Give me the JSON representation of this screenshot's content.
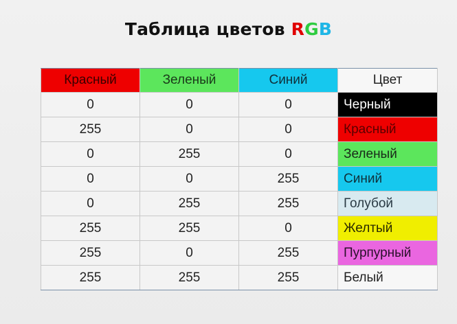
{
  "title": {
    "prefix": "Таблица цветов ",
    "r": "R",
    "g": "G",
    "b": "B"
  },
  "headers": [
    {
      "label": "Красный",
      "bg": "#ee0000",
      "color": "#3a0000"
    },
    {
      "label": "Зеленый",
      "bg": "#5ce65c",
      "color": "#1a3a1a"
    },
    {
      "label": "Синий",
      "bg": "#16c8ee",
      "color": "#10303a"
    },
    {
      "label": "Цвет",
      "bg": "#f7f7f7",
      "color": "#222222"
    }
  ],
  "rows": [
    {
      "r": "0",
      "g": "0",
      "b": "0",
      "name": "Черный",
      "bg": "#000000",
      "text": "#ffffff"
    },
    {
      "r": "255",
      "g": "0",
      "b": "0",
      "name": "Красный",
      "bg": "#ee0000",
      "text": "#5a0000"
    },
    {
      "r": "0",
      "g": "255",
      "b": "0",
      "name": "Зеленый",
      "bg": "#5ce65c",
      "text": "#1a2a1a"
    },
    {
      "r": "0",
      "g": "0",
      "b": "255",
      "name": "Синий",
      "bg": "#16c8ee",
      "text": "#10303a"
    },
    {
      "r": "0",
      "g": "255",
      "b": "255",
      "name": "Голубой",
      "bg": "#d8eaf0",
      "text": "#2a3a44"
    },
    {
      "r": "255",
      "g": "255",
      "b": "0",
      "name": "Желтый",
      "bg": "#f0ee00",
      "text": "#2a2a00"
    },
    {
      "r": "255",
      "g": "0",
      "b": "255",
      "name": "Пурпурный",
      "bg": "#ea66e0",
      "text": "#2a102a"
    },
    {
      "r": "255",
      "g": "255",
      "b": "255",
      "name": "Белый",
      "bg": "#f7f7f7",
      "text": "#222222"
    }
  ]
}
